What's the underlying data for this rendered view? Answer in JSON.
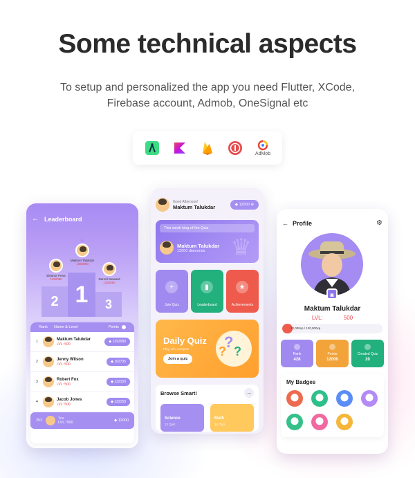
{
  "headline": "Some technical aspects",
  "subtitle_line1": "To setup and personalized the app you need Flutter, XCode,",
  "subtitle_line2": "Firebase account, Admob, OneSignal etc",
  "tech_icons": [
    {
      "icon": "android-studio-icon",
      "color": "#3ddc84"
    },
    {
      "icon": "kotlin-icon",
      "color": "#7f52ff"
    },
    {
      "icon": "firebase-icon",
      "color": "#ffa000"
    },
    {
      "icon": "onesignal-icon",
      "color": "#e54b4d"
    },
    {
      "icon": "admob-icon",
      "label": "AdMob"
    }
  ],
  "leaderboard": {
    "title": "Leaderboard",
    "podium": {
      "first": {
        "name": "Maktum Talukdar",
        "points": "1392080",
        "rank": "1"
      },
      "second": {
        "name": "Eleanor Pena",
        "points": "1392080",
        "rank": "2"
      },
      "third": {
        "name": "Darrell Steward",
        "points": "1392080",
        "rank": "3"
      }
    },
    "columns": {
      "rank": "Rank",
      "name": "Name & Level",
      "points": "Points"
    },
    "rows": [
      {
        "rank": "1",
        "name": "Maktum Talukdar",
        "level": "LVL: 500",
        "points": "1392080"
      },
      {
        "rank": "2",
        "name": "Jenny Wilson",
        "level": "LVL: 500",
        "points": "162735"
      },
      {
        "rank": "3",
        "name": "Robert Fox",
        "level": "LVL: 500",
        "points": "132150"
      },
      {
        "rank": "4",
        "name": "Jacob Jones",
        "level": "LVL: 500",
        "points": "132150"
      }
    ],
    "me": {
      "rank": "252",
      "name": "You",
      "level": "LVL: 500",
      "points": "12000"
    }
  },
  "home": {
    "greeting": "Good Afternoon!",
    "user_name": "Maktum Talukdar",
    "diamonds": "12000",
    "king_title": "This week king of the Quiz",
    "king_name": "Maktum Talukdar",
    "king_diamonds": "12000 diamonds",
    "tiles": [
      {
        "label": "Join Quiz",
        "glyph": "+"
      },
      {
        "label": "Leaderboard",
        "glyph": "▮"
      },
      {
        "label": "Achievements",
        "glyph": "★"
      }
    ],
    "daily_quiz_title": "Daily Quiz",
    "daily_quiz_sub": "Play, win, compete",
    "daily_quiz_button": "Join a quiz",
    "browse_title": "Browse Smart!",
    "categories": [
      {
        "name": "Science",
        "count": "12 Quiz"
      },
      {
        "name": "Math",
        "count": "14 Quiz"
      }
    ]
  },
  "profile": {
    "title": "Profile",
    "name": "Maktum Talukdar",
    "level_label": "LVL:",
    "level_value": "500",
    "xp_text": "12,000xp / 120,000xp",
    "xp_fraction": 0.1,
    "stats": [
      {
        "label": "Rank",
        "value": "428"
      },
      {
        "label": "Points",
        "value": "12000"
      },
      {
        "label": "Created Quiz",
        "value": "20"
      }
    ],
    "badges_title": "My Badges",
    "badge_colors": [
      "#ee6a4f",
      "#2fbf8a",
      "#5b8df6",
      "#b48af5",
      "#35c08a",
      "#f06aa0",
      "#f6b63a"
    ]
  }
}
